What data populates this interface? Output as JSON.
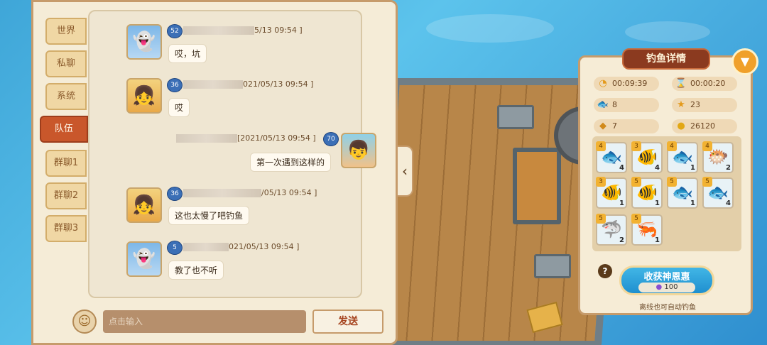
{
  "tabs": [
    "世界",
    "私聊",
    "系统",
    "队伍",
    "群聊1",
    "群聊2",
    "群聊3"
  ],
  "active_tab": "队伍",
  "messages": [
    {
      "level": "52",
      "timestamp": "5/13 09:54 ]",
      "text": "哎，坑"
    },
    {
      "level": "36",
      "timestamp": "021/05/13 09:54 ]",
      "text": "哎"
    },
    {
      "level": "70",
      "timestamp": "[2021/05/13 09:54 ]",
      "text": "第一次遇到这样的"
    },
    {
      "level": "36",
      "timestamp": "/05/13 09:54 ]",
      "text": "这也太慢了吧钓鱼"
    },
    {
      "level": "5",
      "timestamp": "021/05/13 09:54 ]",
      "text": "教了也不听"
    }
  ],
  "input": {
    "placeholder": "点击输入",
    "send_label": "发送"
  },
  "fishing": {
    "title": "钓鱼详情",
    "stats": {
      "time_elapsed": "00:09:39",
      "time_remaining": "00:00:20",
      "caught": "8",
      "stars": "23",
      "bread": "7",
      "coins": "26120"
    },
    "fish": [
      {
        "stars": "4",
        "count": "4",
        "icon": "🐟"
      },
      {
        "stars": "3",
        "count": "4",
        "icon": "🐠"
      },
      {
        "stars": "4",
        "count": "1",
        "icon": "🐟"
      },
      {
        "stars": "4",
        "count": "2",
        "icon": "🐡"
      },
      {
        "stars": "3",
        "count": "1",
        "icon": "🐠"
      },
      {
        "stars": "5",
        "count": "1",
        "icon": "🐠"
      },
      {
        "stars": "5",
        "count": "1",
        "icon": "🐟"
      },
      {
        "stars": "5",
        "count": "4",
        "icon": "🐟"
      },
      {
        "stars": "5",
        "count": "2",
        "icon": "🦈"
      },
      {
        "stars": "5",
        "count": "1",
        "icon": "🦐"
      }
    ],
    "harvest_label": "收获神恩惠",
    "harvest_cost": "100",
    "offline_note": "离线也可自动钓鱼"
  }
}
